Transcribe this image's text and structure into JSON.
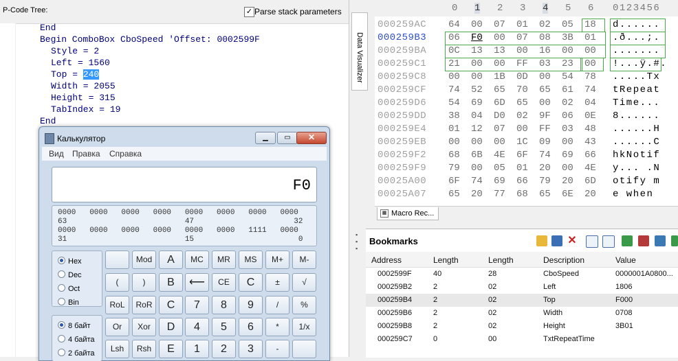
{
  "left_toolbar": {
    "label_a": "P-Code",
    "label_b": "Tree:",
    "parse_label": "Parse stack parameters",
    "parse_checked": "✓"
  },
  "code_lines": [
    {
      "indent": 0,
      "text": "End"
    },
    {
      "indent": 0,
      "text": "Begin ComboBox CboSpeed 'Offset: 0002599F"
    },
    {
      "indent": 1,
      "text": "Style = 2"
    },
    {
      "indent": 1,
      "text": "Left = 1560"
    },
    {
      "indent": 1,
      "pre": "Top = ",
      "sel": "240"
    },
    {
      "indent": 1,
      "text": "Width = 2055"
    },
    {
      "indent": 1,
      "text": "Height = 315"
    },
    {
      "indent": 1,
      "text": "TabIndex = 19"
    },
    {
      "indent": 0,
      "text": "End"
    }
  ],
  "calculator": {
    "title": "Калькулятор",
    "menu": [
      "Вид",
      "Правка",
      "Справка"
    ],
    "display": "F0",
    "bits": [
      "0000   0000   0000   0000   0000   0000   0000   0000",
      "63                          47                      32",
      "0000   0000   0000   0000   0000   0000   1111   0000",
      "31                          15                       0"
    ],
    "base_radios": [
      {
        "label": "Hex",
        "checked": true
      },
      {
        "label": "Dec",
        "checked": false
      },
      {
        "label": "Oct",
        "checked": false
      },
      {
        "label": "Bin",
        "checked": false
      }
    ],
    "size_radios": [
      {
        "label": "8 байт",
        "checked": true
      },
      {
        "label": "4 байта",
        "checked": false
      },
      {
        "label": "2 байта",
        "checked": false
      }
    ],
    "buttons": [
      [
        "",
        "Mod",
        "A",
        "MC",
        "MR",
        "MS",
        "M+",
        "M-"
      ],
      [
        "(",
        ")",
        "B",
        "⟵",
        "CE",
        "C",
        "±",
        "√"
      ],
      [
        "RoL",
        "RoR",
        "C",
        "7",
        "8",
        "9",
        "/",
        "%"
      ],
      [
        "Or",
        "Xor",
        "D",
        "4",
        "5",
        "6",
        "*",
        "1/x"
      ],
      [
        "Lsh",
        "Rsh",
        "E",
        "1",
        "2",
        "3",
        "-",
        ""
      ]
    ]
  },
  "data_visualizer_label": "Data Visualizer",
  "hex": {
    "col_headers": [
      "0",
      "1",
      "2",
      "3",
      "4",
      "5",
      "6"
    ],
    "ascii_header": "0123456",
    "rows": [
      {
        "addr": "000259AC",
        "bytes": [
          "64",
          "00",
          "07",
          "01",
          "02",
          "05",
          "18"
        ],
        "ascii": "d......"
      },
      {
        "addr": "000259B3",
        "bytes": [
          "06",
          "F0",
          "00",
          "07",
          "08",
          "3B",
          "01"
        ],
        "ascii": ".ð...;."
      },
      {
        "addr": "000259BA",
        "bytes": [
          "0C",
          "13",
          "13",
          "00",
          "16",
          "00",
          "00"
        ],
        "ascii": "......."
      },
      {
        "addr": "000259C1",
        "bytes": [
          "21",
          "00",
          "00",
          "FF",
          "03",
          "23",
          "00"
        ],
        "ascii": "!...ÿ.#."
      },
      {
        "addr": "000259C8",
        "bytes": [
          "00",
          "00",
          "1B",
          "0D",
          "00",
          "54",
          "78"
        ],
        "ascii": ".....Tx"
      },
      {
        "addr": "000259CF",
        "bytes": [
          "74",
          "52",
          "65",
          "70",
          "65",
          "61",
          "74"
        ],
        "ascii": "tRepeat"
      },
      {
        "addr": "000259D6",
        "bytes": [
          "54",
          "69",
          "6D",
          "65",
          "00",
          "02",
          "04"
        ],
        "ascii": "Time..."
      },
      {
        "addr": "000259DD",
        "bytes": [
          "38",
          "04",
          "D0",
          "02",
          "9F",
          "06",
          "0E"
        ],
        "ascii": "8......"
      },
      {
        "addr": "000259E4",
        "bytes": [
          "01",
          "12",
          "07",
          "00",
          "FF",
          "03",
          "48"
        ],
        "ascii": "......H"
      },
      {
        "addr": "000259EB",
        "bytes": [
          "00",
          "00",
          "00",
          "1C",
          "09",
          "00",
          "43"
        ],
        "ascii": "......C"
      },
      {
        "addr": "000259F2",
        "bytes": [
          "68",
          "6B",
          "4E",
          "6F",
          "74",
          "69",
          "66"
        ],
        "ascii": "hkNotif"
      },
      {
        "addr": "000259F9",
        "bytes": [
          "79",
          "00",
          "05",
          "01",
          "20",
          "00",
          "4E"
        ],
        "ascii": "y... .N"
      },
      {
        "addr": "00025A00",
        "bytes": [
          "6F",
          "74",
          "69",
          "66",
          "79",
          "20",
          "6D"
        ],
        "ascii": "otify m"
      },
      {
        "addr": "00025A07",
        "bytes": [
          "65",
          "20",
          "77",
          "68",
          "65",
          "6E",
          "20"
        ],
        "ascii": "e when "
      }
    ]
  },
  "macro_tab_label": "Macro Rec...",
  "bookmarks": {
    "title": "Bookmarks",
    "columns": [
      "Address",
      "Length",
      "Length",
      "Description",
      "Value"
    ],
    "rows": [
      {
        "address": "0002599F",
        "length": "40",
        "length_hex": "28",
        "description": "CboSpeed",
        "value": "0000001A0800..."
      },
      {
        "address": "000259B2",
        "length": "2",
        "length_hex": "02",
        "description": "Left",
        "value": "1806"
      },
      {
        "address": "000259B4",
        "length": "2",
        "length_hex": "02",
        "description": "Top",
        "value": "F000"
      },
      {
        "address": "000259B6",
        "length": "2",
        "length_hex": "02",
        "description": "Width",
        "value": "0708"
      },
      {
        "address": "000259B8",
        "length": "2",
        "length_hex": "02",
        "description": "Height",
        "value": "3B01"
      },
      {
        "address": "000259C7",
        "length": "0",
        "length_hex": "00",
        "description": "TxtRepeatTime",
        "value": ""
      }
    ]
  },
  "colors": {
    "accent": "#3399ff",
    "code_blue": "#00007f",
    "hex_box": "#4ba84b",
    "current_addr": "#2f4fcf"
  }
}
